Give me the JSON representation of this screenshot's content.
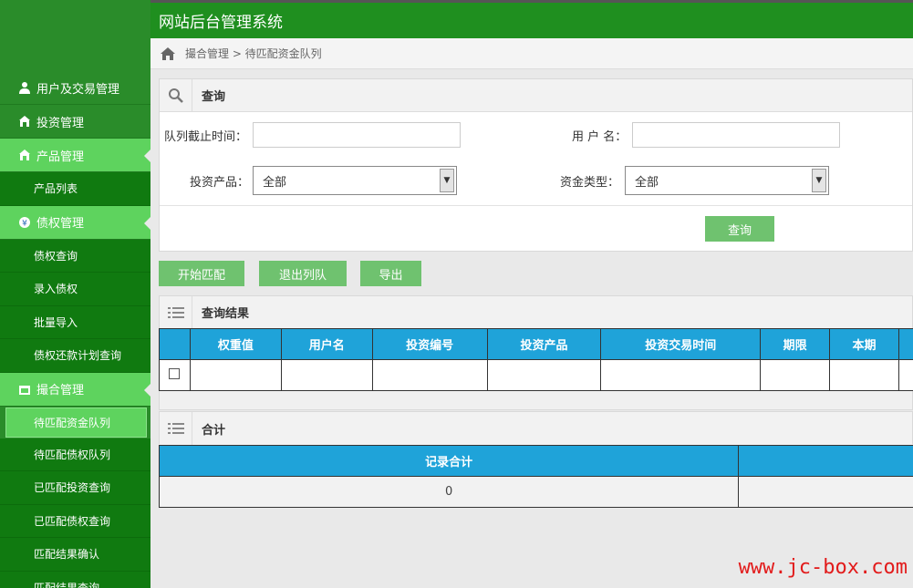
{
  "app": {
    "title": "网站后台管理系统"
  },
  "breadcrumb": {
    "home_icon": "home-icon",
    "path": "撮合管理 > 待匹配资金队列"
  },
  "sidebar": {
    "sections": [
      {
        "label": "用户及交易管理",
        "icon": "user-icon"
      },
      {
        "label": "投资管理",
        "icon": "home-icon"
      },
      {
        "label": "产品管理",
        "icon": "home-icon",
        "active": true
      },
      {
        "label": "债权管理",
        "icon": "yen-icon",
        "active": true
      },
      {
        "label": "撮合管理",
        "icon": "folder-icon",
        "active": true
      }
    ],
    "product_items": [
      "产品列表"
    ],
    "debt_items": [
      "债权查询",
      "录入债权",
      "批量导入",
      "债权还款计划查询"
    ],
    "match_items": [
      "待匹配资金队列",
      "待匹配债权队列",
      "已匹配投资查询",
      "已匹配债权查询",
      "匹配结果确认",
      "匹配结果查询"
    ]
  },
  "search_panel": {
    "title": "查询",
    "fields": {
      "deadline_label": "队列截止时间：",
      "deadline_value": "",
      "username_label": "用 户 名：",
      "username_value": "",
      "product_label": "投资产品：",
      "product_selected": "全部",
      "fund_type_label": "资金类型：",
      "fund_type_selected": "全部"
    },
    "search_button": "查询"
  },
  "actions": {
    "start_match": "开始匹配",
    "exit_queue": "退出列队",
    "export": "导出"
  },
  "results": {
    "title": "查询结果",
    "columns": [
      "权重值",
      "用户名",
      "投资编号",
      "投资产品",
      "投资交易时间",
      "期限",
      "本期"
    ]
  },
  "summary": {
    "title": "合计",
    "columns": [
      "记录合计"
    ],
    "values": [
      "0"
    ]
  },
  "watermark": "www.jc-box.com",
  "colors": {
    "sidebar": "#2a8c2a",
    "topbar": "#1f8f1f",
    "active": "#5ed35e",
    "table_header": "#1fa3d9",
    "button": "#6fc26f",
    "watermark": "#e21b1b"
  }
}
